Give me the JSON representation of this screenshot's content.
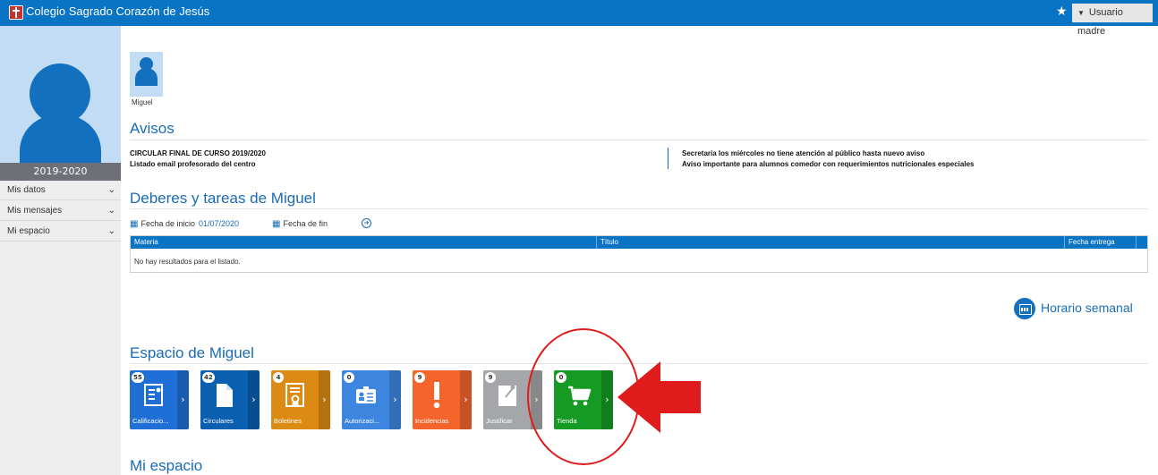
{
  "header": {
    "school_name": "Colegio Sagrado Corazón de Jesús",
    "user_menu": "Usuario madre"
  },
  "sidebar": {
    "year": "2019-2020",
    "items": [
      {
        "label": "Mis datos"
      },
      {
        "label": "Mis mensajes"
      },
      {
        "label": "Mi espacio"
      }
    ]
  },
  "student": {
    "name": "Miguel"
  },
  "avisos": {
    "title": "Avisos",
    "left": [
      "CIRCULAR FINAL DE CURSO 2019/2020",
      "Listado email profesorado del centro"
    ],
    "right": [
      "Secretaría los miércoles no tiene atención al público hasta nuevo aviso",
      "Aviso importante para alumnos comedor con requerimientos nutricionales especiales"
    ]
  },
  "deberes": {
    "title": "Deberes y tareas de Miguel",
    "start_label": "Fecha de inicio",
    "start_value": "01/07/2020",
    "end_label": "Fecha de fin",
    "columns": [
      "Materia",
      "Título",
      "Fecha entrega"
    ],
    "empty_message": "No hay resultados para el listado."
  },
  "schedule_link": "Horario semanal",
  "espacio": {
    "title": "Espacio de Miguel",
    "tiles": [
      {
        "label": "Calificacio...",
        "count": "55",
        "color": "#1f6fd6"
      },
      {
        "label": "Circulares",
        "count": "42",
        "color": "#0a5fb0"
      },
      {
        "label": "Boletines",
        "count": "4",
        "color": "#db8a14"
      },
      {
        "label": "Autorizaci...",
        "count": "0",
        "color": "#3d86e0"
      },
      {
        "label": "Incidencias",
        "count": "9",
        "color": "#f5652b"
      },
      {
        "label": "Justificar",
        "count": "9",
        "color": "#a4a6a9"
      },
      {
        "label": "Tienda",
        "count": "0",
        "color": "#159a24"
      }
    ]
  },
  "mi_espacio": {
    "title": "Mi espacio"
  },
  "annotation_color": "#e01b1b"
}
